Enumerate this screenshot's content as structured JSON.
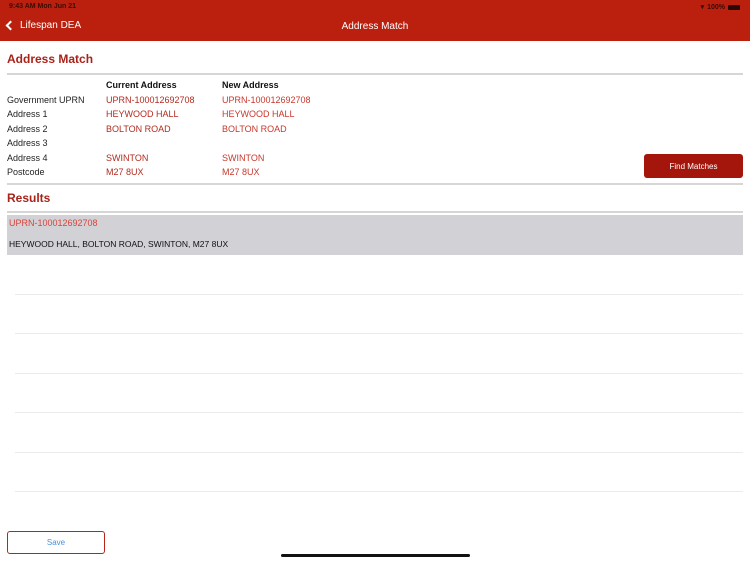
{
  "status_bar": {
    "time": "9:43 AM  Mon Jun 21",
    "battery": "100%",
    "wifi_icon": "wifi-icon",
    "battery_icon": "battery-icon"
  },
  "nav": {
    "back_label": "Lifespan DEA",
    "back_icon": "chevron-left-icon",
    "title": "Address Match",
    "color": "#bb200e"
  },
  "address_match": {
    "title": "Address Match",
    "columns": [
      "Current Address",
      "New Address"
    ],
    "rows": [
      {
        "label": "Government UPRN",
        "current": "UPRN-100012692708",
        "new": "UPRN-100012692708"
      },
      {
        "label": "Address 1",
        "current": "HEYWOOD HALL",
        "new": "HEYWOOD HALL"
      },
      {
        "label": "Address 2",
        "current": "BOLTON ROAD",
        "new": "BOLTON ROAD"
      },
      {
        "label": "Address 3",
        "current": "",
        "new": ""
      },
      {
        "label": "Address 4",
        "current": "SWINTON",
        "new": "SWINTON"
      },
      {
        "label": "Postcode",
        "current": "M27 8UX",
        "new": "M27 8UX"
      }
    ],
    "find_button": "Find Matches"
  },
  "results": {
    "title": "Results",
    "items": [
      {
        "uprn": "UPRN-100012692708",
        "address": "HEYWOOD HALL, BOLTON ROAD, SWINTON, M27 8UX"
      }
    ]
  },
  "footer": {
    "save_label": "Save"
  },
  "colors": {
    "accent": "#bb200e",
    "button": "#a4160c",
    "selected_row": "#d1d1d6",
    "save_text": "#4a90d9"
  }
}
